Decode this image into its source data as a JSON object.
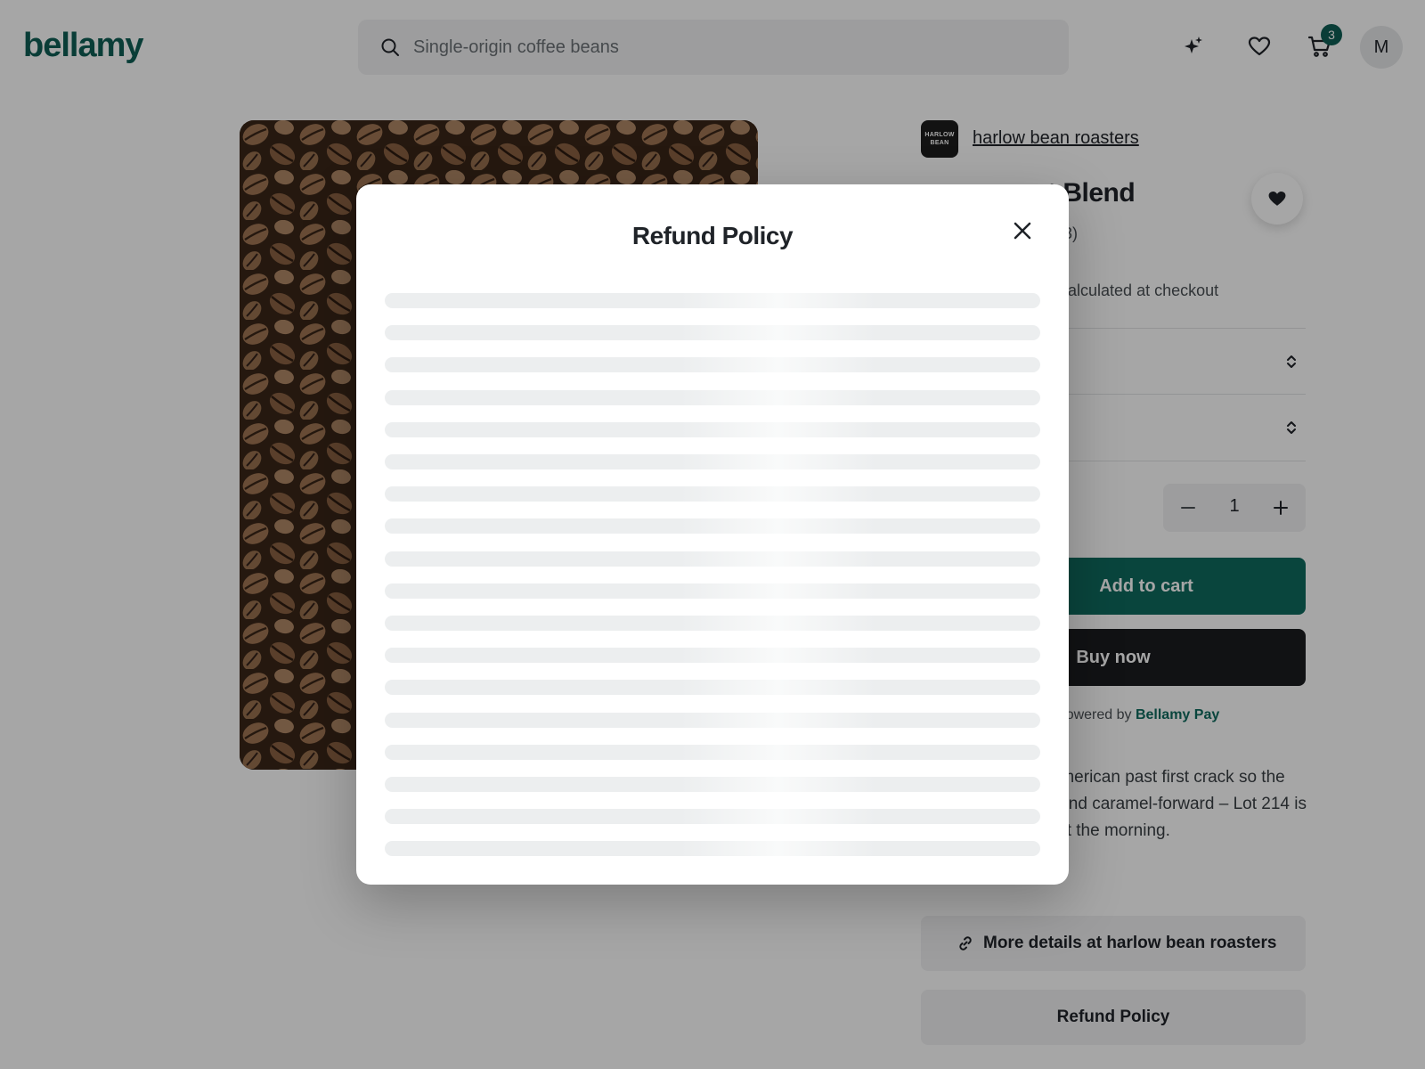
{
  "header": {
    "logo": "bellamy",
    "search_placeholder": "Single-origin coffee beans",
    "cart_count": "3",
    "avatar_initial": "M",
    "icons": [
      "search-icon",
      "sparkle-icon",
      "heart-icon",
      "cart-icon"
    ]
  },
  "product": {
    "vendor_logo_text": "HARLOW BEAN",
    "vendor_name": "harlow bean roasters",
    "title_visible": "t Blend",
    "review_count_visible": "(3)",
    "shipping_note_visible": "g calculated at checkout",
    "quantity": "1",
    "add_to_cart": "Add to cart",
    "buy_now": "Buy now",
    "pay_note_prefix": "ut powered by ",
    "pay_brand": "Bellamy Pay",
    "description_visible": "entral and South American past first crack so the varietals ss. Nutty and caramel-forward – Lot 214 is an easy way to start the morning.",
    "more_details": "More details at harlow bean roasters",
    "refund_policy": "Refund Policy"
  },
  "modal": {
    "title": "Refund Policy",
    "loading_line_count": 18
  },
  "colors": {
    "brand": "#0e5f55",
    "primary_button": "#0e6b5e",
    "dark_button": "#1b1d20",
    "overlay": "rgba(0,0,0,0.35)"
  }
}
